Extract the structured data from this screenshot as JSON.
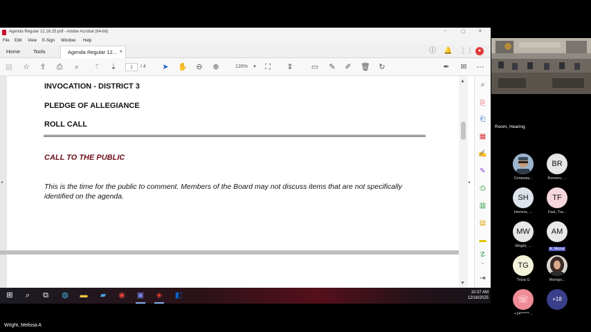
{
  "window": {
    "title": "Agenda Regular 12.16.25.pdf - Adobe Acrobat (64-bit)"
  },
  "menu": [
    "File",
    "Edit",
    "View",
    "E-Sign",
    "Window",
    "Help"
  ],
  "tabs": {
    "home": "Home",
    "tools": "Tools",
    "document": "Agenda Regular 12...",
    "close": "×"
  },
  "toolbar": {
    "page_current": "1",
    "page_total": "/ 4",
    "zoom": "126%"
  },
  "document": {
    "invocation": "INVOCATION - DISTRICT 3",
    "pledge": "PLEDGE OF ALLEGIANCE",
    "roll_call": "ROLL CALL",
    "call_to_public": "CALL TO THE PUBLIC",
    "public_text": "This is the time for the public to comment. Members of the Board may not discuss items that are not specifically identified on the agenda."
  },
  "taskbar": {
    "time": "10:37 AM",
    "date": "12/16/2025"
  },
  "meeting": {
    "room_label": "Room, Hearing",
    "speaker_name": "Wright, Melissa A",
    "participants": [
      {
        "initials": "",
        "name": "Conaway...",
        "color": "#9bb5cc"
      },
      {
        "initials": "BR",
        "name": "Romero, ...",
        "color": "#e6e6e6"
      },
      {
        "initials": "SH",
        "name": "Herrera, ...",
        "color": "#dde3ea"
      },
      {
        "initials": "TF",
        "name": "Fast, Tra...",
        "color": "#f5d6dc"
      },
      {
        "initials": "MW",
        "name": "Wright, ...",
        "color": "#e6e6e6"
      },
      {
        "initials": "AM",
        "name": "A. Morse",
        "color": "#e8e8e8"
      },
      {
        "initials": "TG",
        "name": "Tricia G",
        "color": "#f3f3dc"
      },
      {
        "initials": "",
        "name": "Montgo...",
        "color": "#6b5a52"
      },
      {
        "initials": "",
        "name": "+14******...",
        "color": "#f08c96"
      },
      {
        "initials": "+18",
        "name": "",
        "color": "#3a3f8a"
      }
    ]
  },
  "colors": {
    "red_heading": "#6b0f1a",
    "teams_highlight": "#5b5fc7"
  }
}
